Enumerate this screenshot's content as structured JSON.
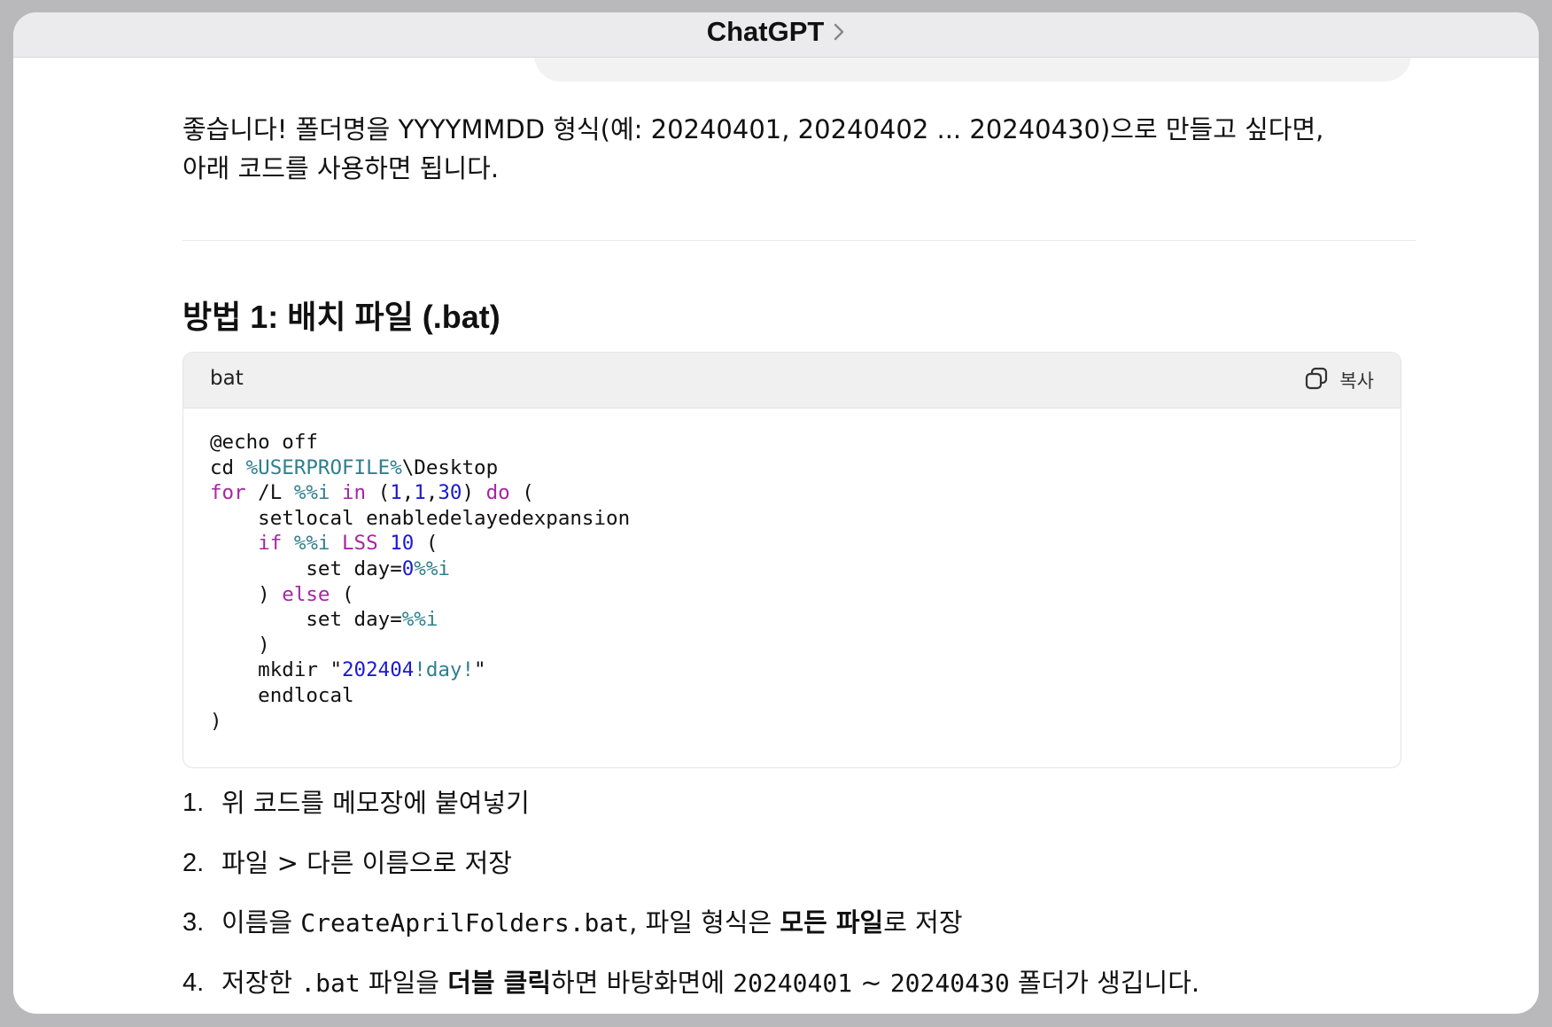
{
  "window": {
    "title": "ChatGPT",
    "title_chevron_icon": "chevron-right-icon"
  },
  "message": {
    "intro_line1": "좋습니다! 폴더명을 YYYYMMDD 형식(예: 20240401, 20240402 ... 20240430)으로 만들고 싶다면,",
    "intro_line2": "아래 코드를 사용하면 됩니다.",
    "heading": "방법 1: 배치 파일 (.bat)",
    "code_block": {
      "language": "bat",
      "copy_label": "복사",
      "copy_icon": "copy-icon",
      "lines": [
        [
          {
            "t": "@echo off",
            "c": "plain"
          }
        ],
        [
          {
            "t": "cd ",
            "c": "plain"
          },
          {
            "t": "%USERPROFILE%",
            "c": "var"
          },
          {
            "t": "\\Desktop",
            "c": "plain"
          }
        ],
        [
          {
            "t": "for",
            "c": "kw"
          },
          {
            "t": " /L ",
            "c": "plain"
          },
          {
            "t": "%%i",
            "c": "var"
          },
          {
            "t": " ",
            "c": "plain"
          },
          {
            "t": "in",
            "c": "kw"
          },
          {
            "t": " (",
            "c": "plain"
          },
          {
            "t": "1",
            "c": "num"
          },
          {
            "t": ",",
            "c": "plain"
          },
          {
            "t": "1",
            "c": "num"
          },
          {
            "t": ",",
            "c": "plain"
          },
          {
            "t": "30",
            "c": "num"
          },
          {
            "t": ") ",
            "c": "plain"
          },
          {
            "t": "do",
            "c": "kw"
          },
          {
            "t": " (",
            "c": "plain"
          }
        ],
        [
          {
            "t": "    setlocal enabledelayedexpansion",
            "c": "plain"
          }
        ],
        [
          {
            "t": "    ",
            "c": "plain"
          },
          {
            "t": "if",
            "c": "kw"
          },
          {
            "t": " ",
            "c": "plain"
          },
          {
            "t": "%%i",
            "c": "var"
          },
          {
            "t": " ",
            "c": "plain"
          },
          {
            "t": "LSS",
            "c": "kw"
          },
          {
            "t": " ",
            "c": "plain"
          },
          {
            "t": "10",
            "c": "num"
          },
          {
            "t": " (",
            "c": "plain"
          }
        ],
        [
          {
            "t": "        set day=",
            "c": "plain"
          },
          {
            "t": "0",
            "c": "num"
          },
          {
            "t": "%%i",
            "c": "var"
          }
        ],
        [
          {
            "t": "    ) ",
            "c": "plain"
          },
          {
            "t": "else",
            "c": "kw"
          },
          {
            "t": " (",
            "c": "plain"
          }
        ],
        [
          {
            "t": "        set day=",
            "c": "plain"
          },
          {
            "t": "%%i",
            "c": "var"
          }
        ],
        [
          {
            "t": "    )",
            "c": "plain"
          }
        ],
        [
          {
            "t": "    mkdir \"",
            "c": "plain"
          },
          {
            "t": "202404",
            "c": "str"
          },
          {
            "t": "!day!",
            "c": "var"
          },
          {
            "t": "\"",
            "c": "plain"
          }
        ],
        [
          {
            "t": "    endlocal",
            "c": "plain"
          }
        ],
        [
          {
            "t": ")",
            "c": "plain"
          }
        ]
      ]
    },
    "steps": [
      {
        "num": "1.",
        "parts": [
          {
            "t": "위 코드를 메모장에 붙여넣기",
            "s": "text"
          }
        ]
      },
      {
        "num": "2.",
        "parts": [
          {
            "t": "파일  >  다른  이름으로  저장",
            "s": "text"
          }
        ]
      },
      {
        "num": "3.",
        "parts": [
          {
            "t": "이름을 ",
            "s": "text"
          },
          {
            "t": "CreateAprilFolders.bat",
            "s": "code"
          },
          {
            "t": ", 파일 형식은 ",
            "s": "text"
          },
          {
            "t": "모든 파일",
            "s": "bold"
          },
          {
            "t": "로 저장",
            "s": "text"
          }
        ]
      },
      {
        "num": "4.",
        "parts": [
          {
            "t": "저장한 ",
            "s": "text"
          },
          {
            "t": ".bat",
            "s": "code"
          },
          {
            "t": " 파일을 ",
            "s": "text"
          },
          {
            "t": "더블 클릭",
            "s": "bold"
          },
          {
            "t": "하면 바탕화면에 ",
            "s": "text"
          },
          {
            "t": "20240401",
            "s": "code"
          },
          {
            "t": " ~ ",
            "s": "text"
          },
          {
            "t": "20240430",
            "s": "code"
          },
          {
            "t": " 폴더가 생깁니다.",
            "s": "text"
          }
        ]
      }
    ]
  }
}
